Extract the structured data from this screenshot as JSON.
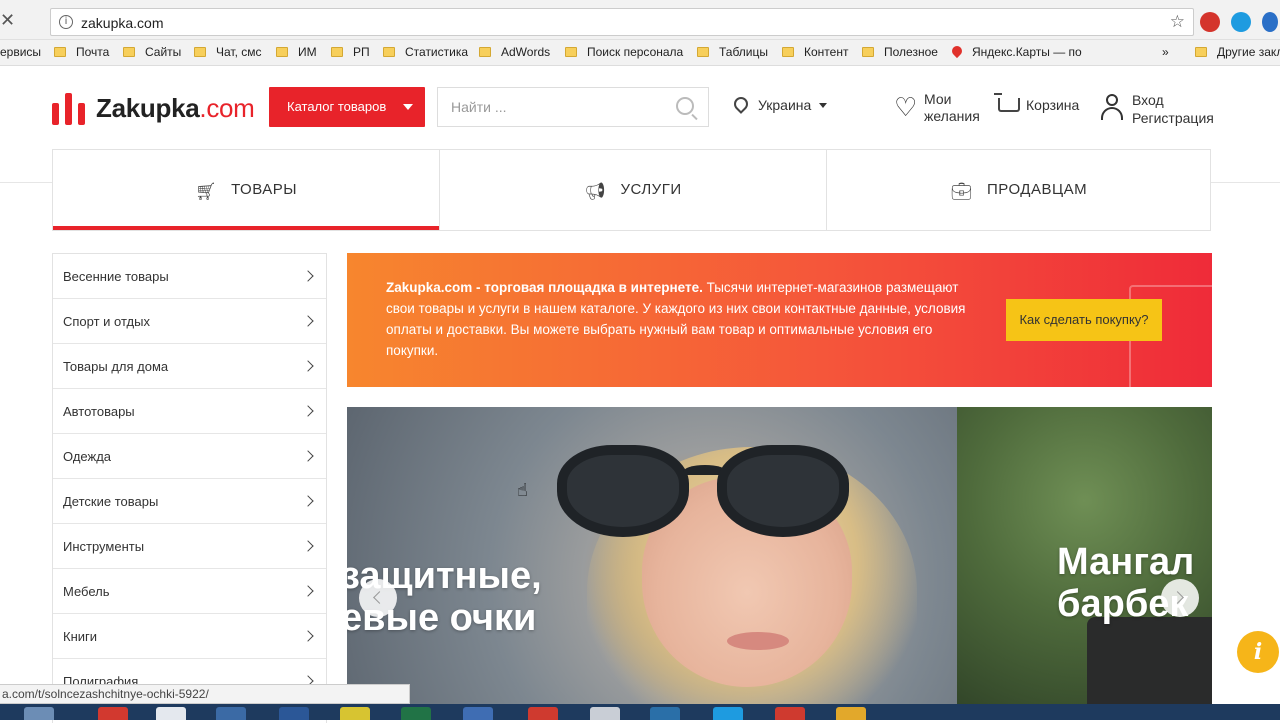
{
  "browser": {
    "url": "zakupka.com",
    "bookmarks": [
      {
        "label": "ервисы",
        "type": "text"
      },
      {
        "label": "Почта",
        "type": "folder"
      },
      {
        "label": "Сайты",
        "type": "folder"
      },
      {
        "label": "Чат, смс",
        "type": "folder"
      },
      {
        "label": "ИМ",
        "type": "folder"
      },
      {
        "label": "РП",
        "type": "folder"
      },
      {
        "label": "Статистика",
        "type": "folder"
      },
      {
        "label": "AdWords",
        "type": "folder"
      },
      {
        "label": "Поиск персонала",
        "type": "folder"
      },
      {
        "label": "Таблицы",
        "type": "folder"
      },
      {
        "label": "Контент",
        "type": "folder"
      },
      {
        "label": "Полезное",
        "type": "folder"
      },
      {
        "label": "Яндекс.Карты — по",
        "type": "pin"
      },
      {
        "label": "»",
        "type": "text"
      },
      {
        "label": "Другие закл",
        "type": "folder"
      }
    ],
    "status_url": "a.com/t/solncezashchitnye-ochki-5922/"
  },
  "header": {
    "logo_name": "Zakupka",
    "logo_domain": ".com",
    "catalog_button": "Каталог товаров",
    "search_placeholder": "Найти ...",
    "region": "Украина",
    "wishlist_line1": "Мои",
    "wishlist_line2": "желания",
    "cart": "Корзина",
    "login": "Вход",
    "register": "Регистрация"
  },
  "tabs": [
    {
      "label": "ТОВАРЫ",
      "icon": "cart-icon",
      "active": true
    },
    {
      "label": "УСЛУГИ",
      "icon": "megaphone-icon",
      "active": false
    },
    {
      "label": "ПРОДАВЦАМ",
      "icon": "briefcase-icon",
      "active": false
    }
  ],
  "categories": [
    "Весенние товары",
    "Спорт и отдых",
    "Товары для дома",
    "Автотовары",
    "Одежда",
    "Детские товары",
    "Инструменты",
    "Мебель",
    "Книги",
    "Полиграфия"
  ],
  "banner": {
    "bold": "Zakupka.com - торговая площадка в интернете.",
    "text": " Тысячи интернет-магазинов размещают свои товары и услуги в нашем каталоге. У каждого из них свои контактные данные, условия оплаты и доставки. Вы можете выбрать нужный вам товар и оптимальные условия его покупки.",
    "button": "Как сделать покупку?"
  },
  "slider": {
    "slide1_line1": "защитные,",
    "slide1_line2": "евые очки",
    "slide2_line1": "Мангал",
    "slide2_line2": "барбек"
  },
  "colors": {
    "brand": "#e8232a",
    "accent_yellow": "#f6c416"
  }
}
